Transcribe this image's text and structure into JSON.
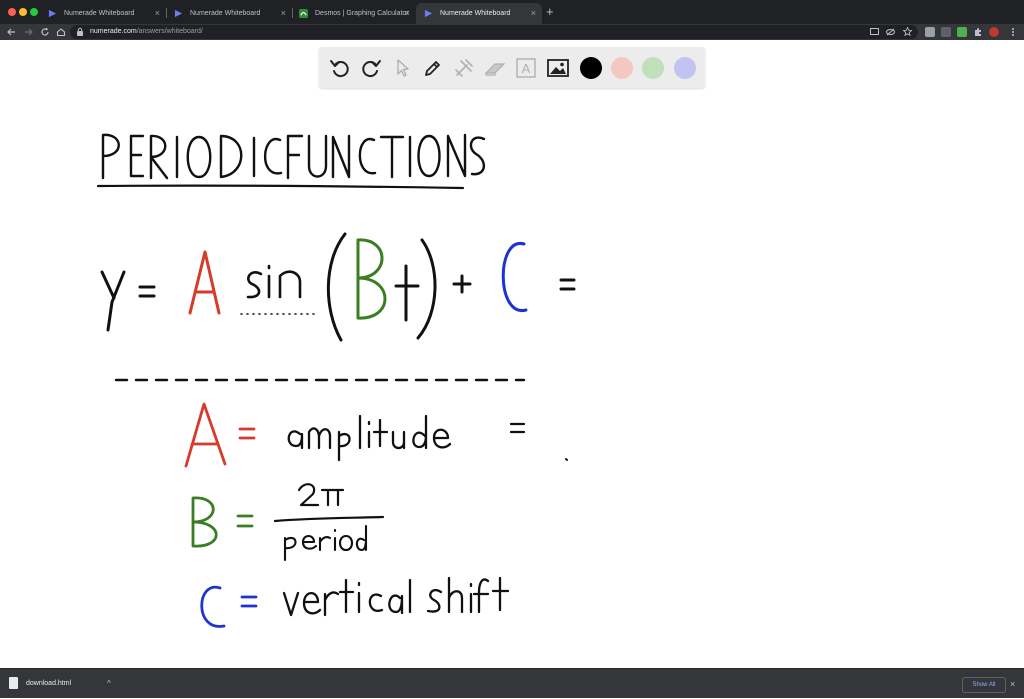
{
  "browser": {
    "tabs": [
      {
        "label": "Numerade Whiteboard",
        "active": false
      },
      {
        "label": "Numerade Whiteboard",
        "active": false
      },
      {
        "label": "Desmos | Graphing Calculator",
        "active": false
      },
      {
        "label": "Numerade Whiteboard",
        "active": true
      }
    ],
    "close_glyph": "×",
    "new_tab_glyph": "+",
    "address": {
      "host": "numerade.com",
      "path": "/answers/whiteboard/"
    }
  },
  "whiteboard": {
    "tools": [
      "undo-icon",
      "redo-icon",
      "select-icon",
      "pen-icon",
      "tools-icon",
      "eraser-icon",
      "text-icon",
      "image-icon"
    ],
    "text_tool_glyph": "A",
    "colors": [
      "#000000",
      "#f4c7c0",
      "#bfe0b8",
      "#c3c3f3"
    ],
    "ink_colors": {
      "black": "#000000",
      "red": "#d63a2a",
      "green": "#3a7d22",
      "blue": "#1e33d1"
    },
    "content": {
      "title": "PERIODIC FUNCTIONS",
      "equation": [
        "y",
        "=",
        "A",
        "sin",
        "(",
        "B",
        "t",
        ")",
        "+",
        "C",
        "="
      ],
      "definitions": [
        {
          "symbol": "A",
          "equals": "=",
          "text": "amplitude",
          "trailing": "="
        },
        {
          "symbol": "B",
          "equals": "=",
          "numerator": "2π",
          "denominator": "period"
        },
        {
          "symbol": "C",
          "equals": "=",
          "text": "vertical shift"
        }
      ]
    }
  },
  "downloads": {
    "file_name": "download.html",
    "chevron": "^",
    "show_all_label": "Show All",
    "close_glyph": "×"
  }
}
